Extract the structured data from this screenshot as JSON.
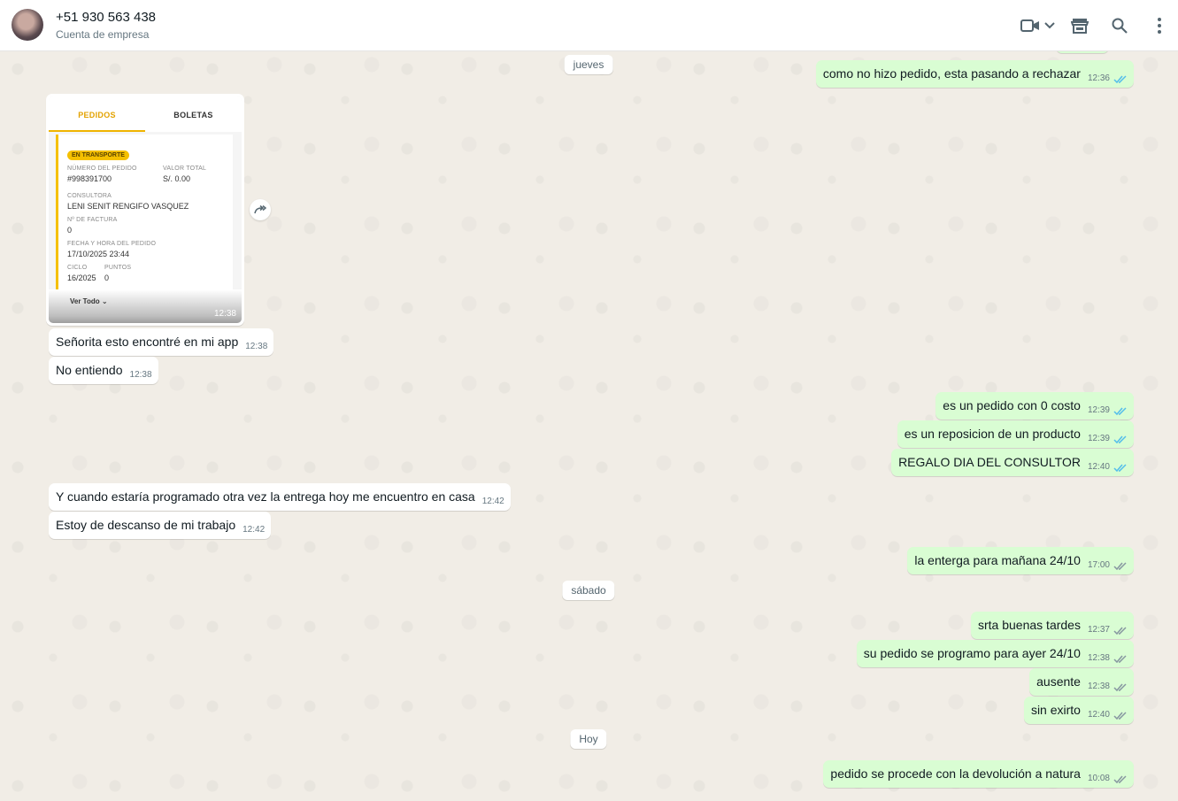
{
  "header": {
    "contact_name": "+51 930 563 438",
    "contact_subtitle": "Cuenta de empresa",
    "icons": [
      "video-call-icon",
      "chevron-down-icon",
      "catalog-store-icon",
      "search-icon",
      "more-options-icon"
    ]
  },
  "date_chips": [
    "jueves",
    "sábado",
    "Hoy"
  ],
  "image_message": {
    "tabs": [
      "PEDIDOS",
      "BOLETAS"
    ],
    "status_badge": "EN TRANSPORTE",
    "fields": {
      "order_number_label": "NÚMERO DEL PEDIDO",
      "order_number": "#998391700",
      "total_label": "VALOR TOTAL",
      "total": "S/. 0.00",
      "consultant_label": "CONSULTORA",
      "consultant": "LENI SENIT RENGIFO VASQUEZ",
      "invoice_label": "Nº DE FACTURA",
      "invoice": "0",
      "datetime_label": "FECHA Y HORA DEL PEDIDO",
      "datetime": "17/10/2025 23:44",
      "cycle_label": "CICLO",
      "cycle": "16/2025",
      "points_label": "PUNTOS",
      "points": "0"
    },
    "see_all": "Ver Todo",
    "time": "12:38"
  },
  "messages": [
    {
      "dir": "out",
      "text": "como no hizo pedido, esta pasando a rechazar",
      "time": "12:36",
      "read": true
    },
    {
      "dir": "in",
      "text": "Señorita esto encontré en mi app",
      "time": "12:38"
    },
    {
      "dir": "in",
      "text": "No entiendo",
      "time": "12:38"
    },
    {
      "dir": "out",
      "text": "es un pedido con 0 costo",
      "time": "12:39",
      "read": true
    },
    {
      "dir": "out",
      "text": "es un reposicion de un producto",
      "time": "12:39",
      "read": true
    },
    {
      "dir": "out",
      "text": "REGALO DIA DEL CONSULTOR",
      "time": "12:40",
      "read": true
    },
    {
      "dir": "in",
      "text": "Y cuando estaría programado otra vez la entrega hoy me encuentro en casa",
      "time": "12:42"
    },
    {
      "dir": "in",
      "text": "Estoy de descanso de mi trabajo",
      "time": "12:42"
    },
    {
      "dir": "out",
      "text": "la enterga para mañana 24/10",
      "time": "17:00",
      "read": false
    },
    {
      "dir": "out",
      "text": "srta buenas tardes",
      "time": "12:37",
      "read": false
    },
    {
      "dir": "out",
      "text": "su pedido se programo para ayer  24/10",
      "time": "12:38",
      "read": false
    },
    {
      "dir": "out",
      "text": "ausente",
      "time": "12:38",
      "read": false
    },
    {
      "dir": "out",
      "text": "sin exirto",
      "time": "12:40",
      "read": false
    },
    {
      "dir": "out",
      "text": "pedido se procede con la devolución a natura",
      "time": "10:08",
      "read": false
    }
  ],
  "colors": {
    "outgoing_bubble": "#d9fdd3",
    "incoming_bubble": "#ffffff",
    "read_ticks": "#53bdeb",
    "delivered_ticks": "#8696a0",
    "chat_background": "#f1ede6"
  }
}
